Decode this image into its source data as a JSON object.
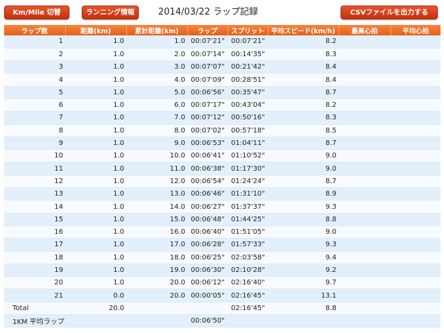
{
  "header": {
    "km_mile_button": "Km/Mile 切替",
    "running_info_button": "ランニング情報",
    "title": "2014/03/22 ラップ記録",
    "csv_button": "CSVファイルを出力する"
  },
  "table": {
    "columns": [
      "ラップ数",
      "距離(km)",
      "累計距離(km)",
      "ラップ",
      "スプリット",
      "平均スピード(km/h)",
      "最高心拍",
      "平均心拍"
    ],
    "rows": [
      [
        "1",
        "1.0",
        "1.0",
        "00:07'21\"",
        "00:07'21\"",
        "8.2",
        "",
        ""
      ],
      [
        "2",
        "1.0",
        "2.0",
        "00:07'14\"",
        "00:14'35\"",
        "8.3",
        "",
        ""
      ],
      [
        "3",
        "1.0",
        "3.0",
        "00:07'07\"",
        "00:21'42\"",
        "8.4",
        "",
        ""
      ],
      [
        "4",
        "1.0",
        "4.0",
        "00:07'09\"",
        "00:28'51\"",
        "8.4",
        "",
        ""
      ],
      [
        "5",
        "1.0",
        "5.0",
        "00:06'56\"",
        "00:35'47\"",
        "8.7",
        "",
        ""
      ],
      [
        "6",
        "1.0",
        "6.0",
        "00:07'17\"",
        "00:43'04\"",
        "8.2",
        "",
        ""
      ],
      [
        "7",
        "1.0",
        "7.0",
        "00:07'12\"",
        "00:50'16\"",
        "8.3",
        "",
        ""
      ],
      [
        "8",
        "1.0",
        "8.0",
        "00:07'02\"",
        "00:57'18\"",
        "8.5",
        "",
        ""
      ],
      [
        "9",
        "1.0",
        "9.0",
        "00:06'53\"",
        "01:04'11\"",
        "8.7",
        "",
        ""
      ],
      [
        "10",
        "1.0",
        "10.0",
        "00:06'41\"",
        "01:10'52\"",
        "9.0",
        "",
        ""
      ],
      [
        "11",
        "1.0",
        "11.0",
        "00:06'38\"",
        "01:17'30\"",
        "9.0",
        "",
        ""
      ],
      [
        "12",
        "1.0",
        "12.0",
        "00:06'54\"",
        "01:24'24\"",
        "8.7",
        "",
        ""
      ],
      [
        "13",
        "1.0",
        "13.0",
        "00:06'46\"",
        "01:31'10\"",
        "8.9",
        "",
        ""
      ],
      [
        "14",
        "1.0",
        "14.0",
        "00:06'27\"",
        "01:37'37\"",
        "9.3",
        "",
        ""
      ],
      [
        "15",
        "1.0",
        "15.0",
        "00:06'48\"",
        "01:44'25\"",
        "8.8",
        "",
        ""
      ],
      [
        "16",
        "1.0",
        "16.0",
        "00:06'40\"",
        "01:51'05\"",
        "9.0",
        "",
        ""
      ],
      [
        "17",
        "1.0",
        "17.0",
        "00:06'28\"",
        "01:57'33\"",
        "9.3",
        "",
        ""
      ],
      [
        "18",
        "1.0",
        "18.0",
        "00:06'25\"",
        "02:03'58\"",
        "9.4",
        "",
        ""
      ],
      [
        "19",
        "1.0",
        "19.0",
        "00:06'30\"",
        "02:10'28\"",
        "9.2",
        "",
        ""
      ],
      [
        "20",
        "1.0",
        "20.0",
        "00:06'12\"",
        "02:16'40\"",
        "9.7",
        "",
        ""
      ],
      [
        "21",
        "0.0",
        "20.0",
        "00:00'05\"",
        "02:16'45\"",
        "13.1",
        "",
        ""
      ]
    ],
    "total": {
      "label": "Total",
      "distance": "20.0",
      "split": "02:16'45\"",
      "avg_speed": "8.8"
    },
    "avg_lap": {
      "label": "1KM 平均ラップ",
      "lap": "00:06'50\""
    }
  }
}
